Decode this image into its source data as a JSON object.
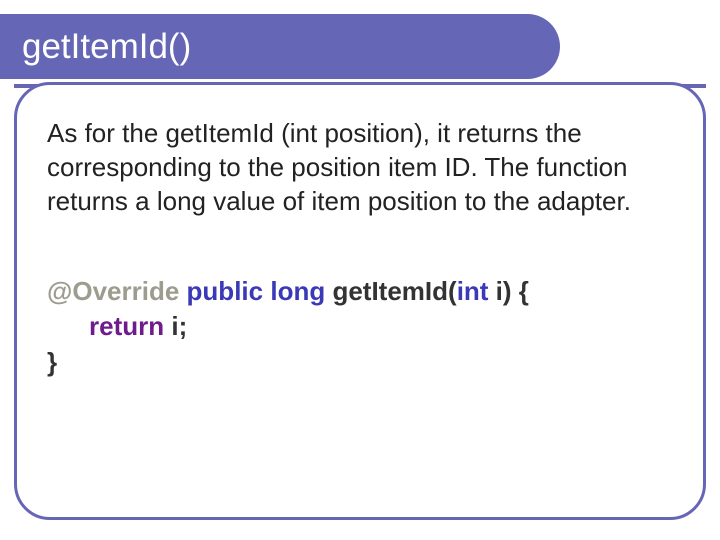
{
  "header": {
    "title": "getItemId()"
  },
  "body": {
    "description": "As for the getItemId (int position), it returns the corresponding to the position item ID. The function returns a long value of item position to the adapter."
  },
  "code": {
    "annotation": "@Override",
    "kw_public": "public",
    "kw_long": "long",
    "fn_name": "getItemId(",
    "kw_int": "int",
    "param_close": " i) {",
    "kw_return": "return",
    "stmt_end": " i;",
    "close_brace": "}"
  }
}
